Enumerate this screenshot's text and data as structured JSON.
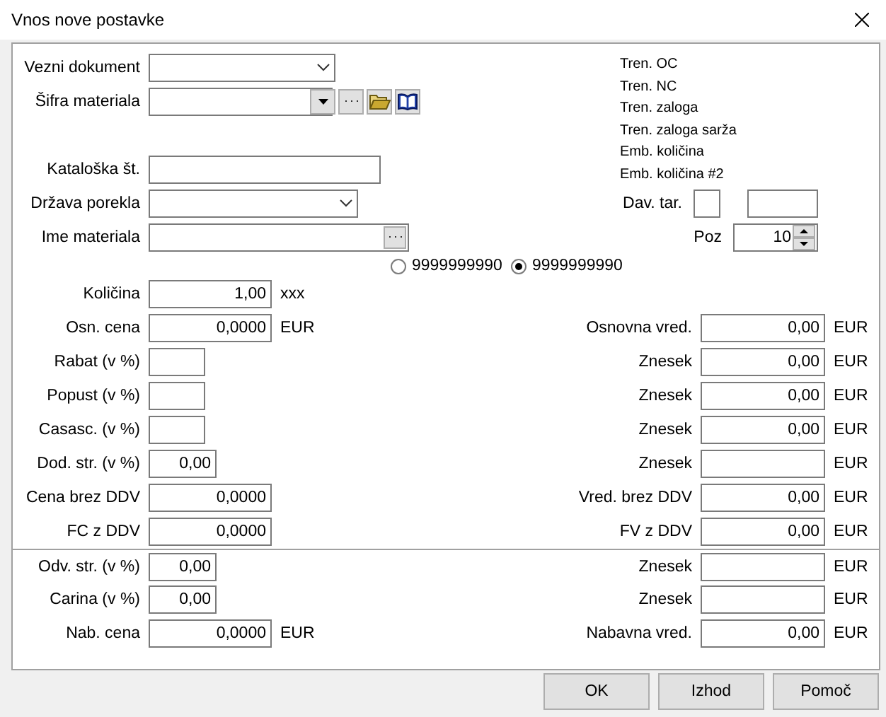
{
  "window": {
    "title": "Vnos nove postavke"
  },
  "header_fields": [
    {
      "label": "Vezni dokument",
      "kind": "dropdown"
    },
    {
      "label": "Šifra materiala",
      "kind": "lookup"
    },
    {
      "kind": "spacer"
    },
    {
      "label": "Kataloška št.",
      "kind": "text"
    },
    {
      "label": "Država porekla",
      "kind": "dropdown"
    },
    {
      "label": "Ime materiala",
      "kind": "browse"
    }
  ],
  "info_list": [
    "Tren. OC",
    "Tren. NC",
    "Tren. zaloga",
    "Tren. zaloga sarža",
    "Emb. količina",
    "Emb. količina #2"
  ],
  "tax": {
    "label": "Dav. tar."
  },
  "position": {
    "label": "Poz",
    "value": "10"
  },
  "radios": [
    {
      "label": "9999999990",
      "selected": false
    },
    {
      "label": "9999999990",
      "selected": true
    }
  ],
  "sections": [
    [
      {
        "left": {
          "label": "Količina",
          "value": "1,00",
          "unit": "xxx",
          "kind": "amount"
        }
      },
      {
        "left": {
          "label": "Osn. cena",
          "value": "0,0000",
          "unit": "EUR",
          "kind": "amount"
        },
        "right": {
          "label": "Osnovna vred.",
          "value": "0,00",
          "unit": "EUR"
        }
      },
      {
        "left": {
          "label": "Rabat (v %)",
          "kind": "percent"
        },
        "right": {
          "label": "Znesek",
          "value": "0,00",
          "unit": "EUR"
        }
      },
      {
        "left": {
          "label": "Popust (v %)",
          "kind": "percent"
        },
        "right": {
          "label": "Znesek",
          "value": "0,00",
          "unit": "EUR"
        }
      },
      {
        "left": {
          "label": "Casasc. (v %)",
          "kind": "percent"
        },
        "right": {
          "label": "Znesek",
          "value": "0,00",
          "unit": "EUR"
        }
      },
      {
        "left": {
          "label": "Dod. str. (v %)",
          "value": "0,00",
          "kind": "rate"
        },
        "right": {
          "label": "Znesek",
          "unit": "EUR"
        }
      },
      {
        "left": {
          "label": "Cena brez DDV",
          "value": "0,0000",
          "kind": "amount"
        },
        "right": {
          "label": "Vred. brez DDV",
          "value": "0,00",
          "unit": "EUR"
        }
      },
      {
        "left": {
          "label": "FC z DDV",
          "value": "0,0000",
          "kind": "amount"
        },
        "right": {
          "label": "FV z DDV",
          "value": "0,00",
          "unit": "EUR"
        }
      }
    ],
    [
      {
        "left": {
          "label": "Odv. str. (v %)",
          "value": "0,00",
          "kind": "rate"
        },
        "right": {
          "label": "Znesek",
          "unit": "EUR"
        }
      },
      {
        "left": {
          "label": "Carina (v %)",
          "value": "0,00",
          "kind": "rate"
        },
        "right": {
          "label": "Znesek",
          "unit": "EUR"
        }
      },
      {
        "left": {
          "label": "Nab. cena",
          "value": "0,0000",
          "unit": "EUR",
          "kind": "amount"
        },
        "right": {
          "label": "Nabavna vred.",
          "value": "0,00",
          "unit": "EUR"
        }
      }
    ]
  ],
  "buttons": [
    "OK",
    "Izhod",
    "Pomoč"
  ]
}
